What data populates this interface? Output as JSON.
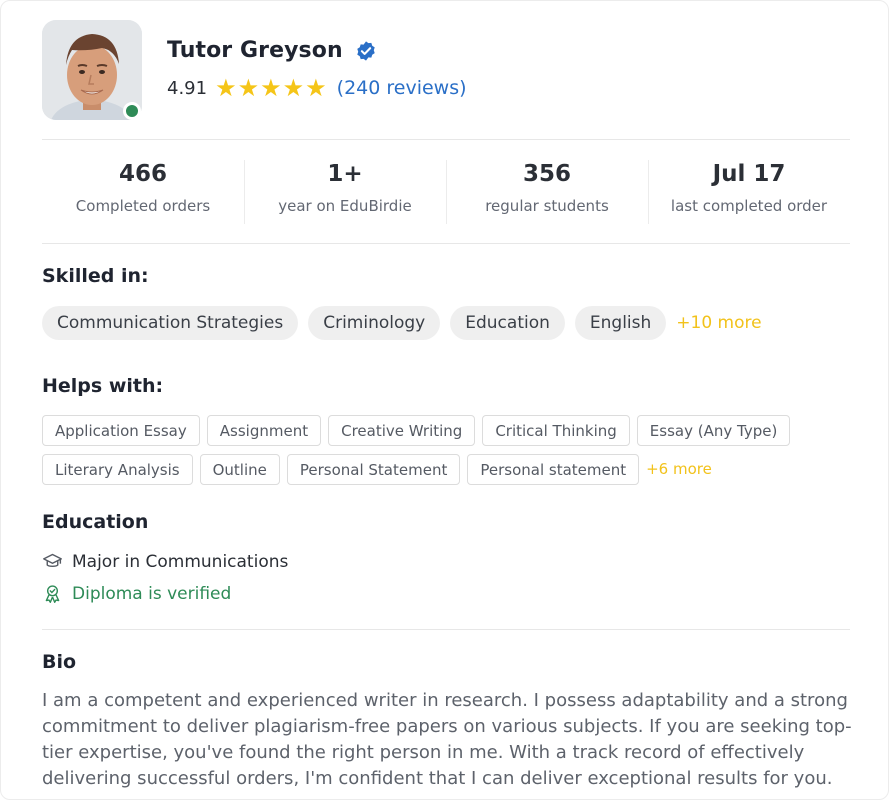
{
  "profile": {
    "name": "Tutor Greyson",
    "rating": "4.91",
    "stars": 5,
    "reviews": "(240 reviews)",
    "online": true
  },
  "stats": [
    {
      "value": "466",
      "label": "Completed orders"
    },
    {
      "value": "1+",
      "label": "year on EduBirdie"
    },
    {
      "value": "356",
      "label": "regular students"
    },
    {
      "value": "Jul 17",
      "label": "last completed order"
    }
  ],
  "skills": {
    "title": "Skilled in:",
    "items": [
      "Communication Strategies",
      "Criminology",
      "Education",
      "English"
    ],
    "more": "+10 more"
  },
  "helps": {
    "title": "Helps with:",
    "items": [
      "Application Essay",
      "Assignment",
      "Creative Writing",
      "Critical Thinking",
      "Essay (Any Type)",
      "Literary Analysis",
      "Outline",
      "Personal Statement",
      "Personal statement"
    ],
    "more": "+6 more"
  },
  "education": {
    "title": "Education",
    "major": "Major in Communications",
    "verified": "Diploma is verified"
  },
  "bio": {
    "title": "Bio",
    "text": "I am a competent and experienced writer in research. I possess adaptability and a strong commitment to deliver plagiarism-free papers on various subjects. If you are seeking top-tier expertise, you've found the right person in me. With a track record of effectively delivering successful orders, I'm confident that I can deliver exceptional results for you."
  },
  "colors": {
    "accent_star": "#f5c518",
    "link": "#2a6fc7",
    "verified_green": "#2e8b57",
    "more_yellow": "#f2c21b"
  },
  "icons": [
    "verified-badge-icon",
    "star-icon",
    "graduation-cap-icon",
    "diploma-ribbon-icon"
  ]
}
